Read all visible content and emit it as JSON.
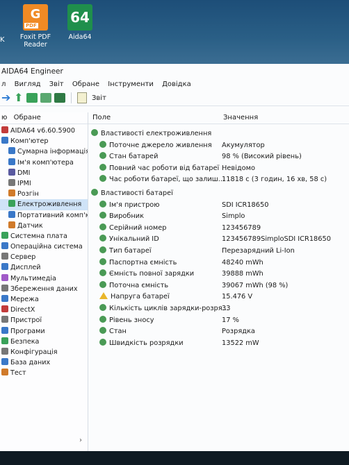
{
  "desktop": {
    "partial_left": "K",
    "icons": [
      {
        "label_line1": "Foxit PDF",
        "label_line2": "Reader",
        "glyph": "G",
        "badge": "PDF"
      },
      {
        "label_line1": "Aida64",
        "glyph": "64"
      }
    ]
  },
  "window": {
    "title": "AIDA64 Engineer",
    "menu": [
      "л",
      "Вигляд",
      "Звіт",
      "Обране",
      "Інструменти",
      "Довідка"
    ],
    "toolbar": {
      "report_label": "Звіт"
    }
  },
  "left_pane": {
    "tabs": [
      "ю",
      "Обране"
    ],
    "tree": [
      {
        "label": "AIDA64 v6.60.5900",
        "level": 1,
        "icon_color": "#c23b3b"
      },
      {
        "label": "Комп'ютер",
        "level": 1,
        "icon_color": "#3a78c8"
      },
      {
        "label": "Сумарна інформація",
        "level": 2,
        "icon_color": "#3a78c8"
      },
      {
        "label": "Ім'я комп'ютера",
        "level": 2,
        "icon_color": "#3a78c8"
      },
      {
        "label": "DMI",
        "level": 2,
        "icon_color": "#5a5aa0"
      },
      {
        "label": "IPMI",
        "level": 2,
        "icon_color": "#777"
      },
      {
        "label": "Розгін",
        "level": 2,
        "icon_color": "#d07a2a"
      },
      {
        "label": "Електроживлення",
        "level": 2,
        "icon_color": "#3aa25a",
        "selected": true
      },
      {
        "label": "Портативний комп'ют",
        "level": 2,
        "icon_color": "#3a78c8"
      },
      {
        "label": "Датчик",
        "level": 2,
        "icon_color": "#d07a2a"
      },
      {
        "label": "Системна плата",
        "level": 1,
        "icon_color": "#3aa25a"
      },
      {
        "label": "Операційна система",
        "level": 1,
        "icon_color": "#3a78c8"
      },
      {
        "label": "Сервер",
        "level": 1,
        "icon_color": "#777"
      },
      {
        "label": "Дисплей",
        "level": 1,
        "icon_color": "#3a78c8"
      },
      {
        "label": "Мультимедіа",
        "level": 1,
        "icon_color": "#a05ac8"
      },
      {
        "label": "Збереження даних",
        "level": 1,
        "icon_color": "#777"
      },
      {
        "label": "Мережа",
        "level": 1,
        "icon_color": "#3a78c8"
      },
      {
        "label": "DirectX",
        "level": 1,
        "icon_color": "#c23b3b"
      },
      {
        "label": "Пристрої",
        "level": 1,
        "icon_color": "#777"
      },
      {
        "label": "Програми",
        "level": 1,
        "icon_color": "#3a78c8"
      },
      {
        "label": "Безпека",
        "level": 1,
        "icon_color": "#3aa25a"
      },
      {
        "label": "Конфігурація",
        "level": 1,
        "icon_color": "#777"
      },
      {
        "label": "База даних",
        "level": 1,
        "icon_color": "#3a78c8"
      },
      {
        "label": "Тест",
        "level": 1,
        "icon_color": "#d07a2a"
      }
    ]
  },
  "right_pane": {
    "columns": {
      "field": "Поле",
      "value": "Значення"
    },
    "sections": [
      {
        "title": "Властивості електроживлення",
        "rows": [
          {
            "field": "Поточне джерело живлення",
            "value": "Акумулятор"
          },
          {
            "field": "Стан батарей",
            "value": "98 % (Високий рівень)"
          },
          {
            "field": "Повний час роботи від батареї",
            "value": "Невідомо"
          },
          {
            "field": "Час роботи батареї, що залиш...",
            "value": "11818 с (3 годин, 16 хв, 58 с)"
          }
        ]
      },
      {
        "title": "Властивості батареї",
        "rows": [
          {
            "field": "Ім'я пристрою",
            "value": "SDI ICR18650"
          },
          {
            "field": "Виробник",
            "value": "Simplo"
          },
          {
            "field": "Серійний номер",
            "value": "123456789"
          },
          {
            "field": "Унікальний ID",
            "value": "123456789SimploSDI ICR18650"
          },
          {
            "field": "Тип батареї",
            "value": "Перезарядний Li-Ion"
          },
          {
            "field": "Паспортна ємність",
            "value": "48240 mWh"
          },
          {
            "field": "Ємність повної зарядки",
            "value": "39888 mWh"
          },
          {
            "field": "Поточна ємність",
            "value": "39067 mWh  (98 %)"
          },
          {
            "field": "Напруга батареї",
            "value": "15.476 V",
            "warning": true
          },
          {
            "field": "Кількість циклів зарядки-розря...",
            "value": "33"
          },
          {
            "field": "Рівень зносу",
            "value": "17 %"
          },
          {
            "field": "Стан",
            "value": "Розрядка"
          },
          {
            "field": "Швидкість розрядки",
            "value": "13522 mW"
          }
        ]
      }
    ]
  }
}
